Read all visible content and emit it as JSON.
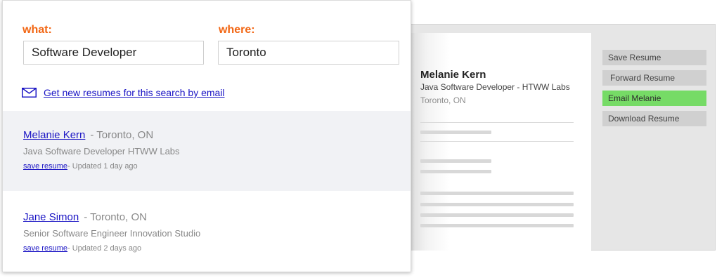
{
  "search": {
    "what_label": "what:",
    "what_value": "Software Developer",
    "where_label": "where:",
    "where_value": "Toronto",
    "email_alert_link": "Get new resumes for this search by email"
  },
  "results": [
    {
      "name": "Melanie Kern",
      "location": "- Toronto, ON",
      "title": "Java Software Developer HTWW Labs",
      "save_label": "save resume",
      "updated": "- Updated 1 day ago",
      "selected": true
    },
    {
      "name": "Jane Simon",
      "location": "- Toronto, ON",
      "title": "Senior Software Engineer Innovation Studio",
      "save_label": "save resume",
      "updated": "- Updated 2 days ago",
      "selected": false
    }
  ],
  "preview": {
    "name": "Melanie Kern",
    "role": "Java Software Developer - HTWW Labs",
    "location": "Toronto, ON",
    "actions": {
      "save": "Save Resume",
      "forward": "Forward Resume",
      "email": "Email Melanie",
      "download": "Download Resume"
    }
  },
  "colors": {
    "label_orange": "#f26512",
    "link_blue": "#1a14c4",
    "email_button_green": "#76db66",
    "selected_row": "#f1f2f5"
  },
  "icons": {
    "email_alert": "envelope-icon"
  }
}
